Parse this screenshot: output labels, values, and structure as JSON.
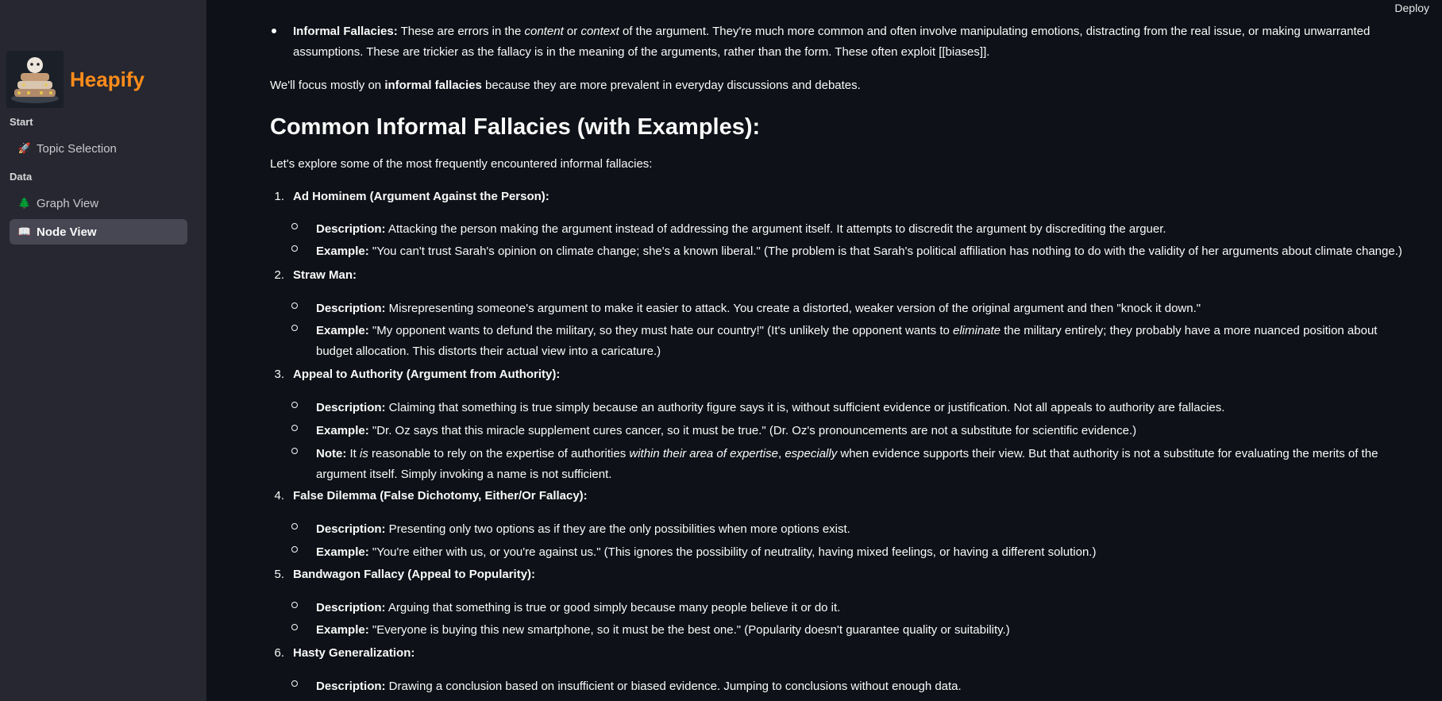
{
  "header": {
    "deploy_label": "Deploy"
  },
  "sidebar": {
    "app_title": "Heapify",
    "sections": [
      {
        "label": "Start",
        "items": [
          {
            "icon": "rocket-icon",
            "glyph": "🚀",
            "label": "Topic Selection"
          }
        ]
      },
      {
        "label": "Data",
        "items": [
          {
            "icon": "tree-icon",
            "glyph": "🌲",
            "label": "Graph View"
          },
          {
            "icon": "book-icon",
            "glyph": "📖",
            "label": "Node View",
            "active": true
          }
        ]
      }
    ]
  },
  "content": {
    "intro_bullet": {
      "term": "Informal Fallacies:",
      "p1": " These are errors in the ",
      "em1": "content",
      "p2": " or ",
      "em2": "context",
      "p3": " of the argument. They're much more common and often involve manipulating emotions, distracting from the real issue, or making unwarranted",
      "line2": "assumptions. These are trickier as the fallacy is in the meaning of the arguments, rather than the form. These often exploit [[biases]]."
    },
    "focus": {
      "pre": "We'll focus mostly on ",
      "strong": "informal fallacies",
      "post": " because they are more prevalent in everyday discussions and debates."
    },
    "heading": "Common Informal Fallacies (with Examples):",
    "lead": "Let's explore some of the most frequently encountered informal fallacies:",
    "fallacies": [
      {
        "num": "1.",
        "title": "Ad Hominem (Argument Against the Person):"
      },
      {
        "num": "2.",
        "title": "Straw Man:"
      },
      {
        "num": "3.",
        "title": "Appeal to Authority (Argument from Authority):"
      },
      {
        "num": "4.",
        "title": "False Dilemma (False Dichotomy, Either/Or Fallacy):"
      },
      {
        "num": "5.",
        "title": "Bandwagon Fallacy (Appeal to Popularity):"
      },
      {
        "num": "6.",
        "title": "Hasty Generalization:"
      }
    ],
    "label_description": "Description:",
    "label_example": "Example:",
    "label_note": "Note:",
    "f1_desc": " Attacking the person making the argument instead of addressing the argument itself. It attempts to discredit the argument by discrediting the arguer.",
    "f1_ex": " \"You can't trust Sarah's opinion on climate change; she's a known liberal.\" (The problem is that Sarah's political affiliation has nothing to do with the validity of her arguments about climate change.)",
    "f2_desc": " Misrepresenting someone's argument to make it easier to attack. You create a distorted, weaker version of the original argument and then \"knock it down.\"",
    "f2_ex_a": " \"My opponent wants to defund the military, so they must hate our country!\" (It's unlikely the opponent wants to ",
    "f2_ex_em": "eliminate",
    "f2_ex_b": " the military entirely; they probably have a more nuanced position about",
    "f2_ex_line2": "budget allocation. This distorts their actual view into a caricature.)",
    "f3_desc": " Claiming that something is true simply because an authority figure says it is, without sufficient evidence or justification. Not all appeals to authority are fallacies.",
    "f3_ex": " \"Dr. Oz says that this miracle supplement cures cancer, so it must be true.\" (Dr. Oz's pronouncements are not a substitute for scientific evidence.)",
    "f3_note_a": " It ",
    "f3_note_em1": "is",
    "f3_note_b": " reasonable to rely on the expertise of authorities ",
    "f3_note_em2": "within their area of expertise",
    "f3_note_c": ", ",
    "f3_note_em3": "especially",
    "f3_note_d": " when evidence supports their view. But that authority is not a substitute for evaluating the merits of the",
    "f3_note_line2": "argument itself. Simply invoking a name is not sufficient.",
    "f4_desc": " Presenting only two options as if they are the only possibilities when more options exist.",
    "f4_ex": " \"You're either with us, or you're against us.\" (This ignores the possibility of neutrality, having mixed feelings, or having a different solution.)",
    "f5_desc": " Arguing that something is true or good simply because many people believe it or do it.",
    "f5_ex": " \"Everyone is buying this new smartphone, so it must be the best one.\" (Popularity doesn't guarantee quality or suitability.)",
    "f6_desc": " Drawing a conclusion based on insufficient or biased evidence. Jumping to conclusions without enough data."
  }
}
